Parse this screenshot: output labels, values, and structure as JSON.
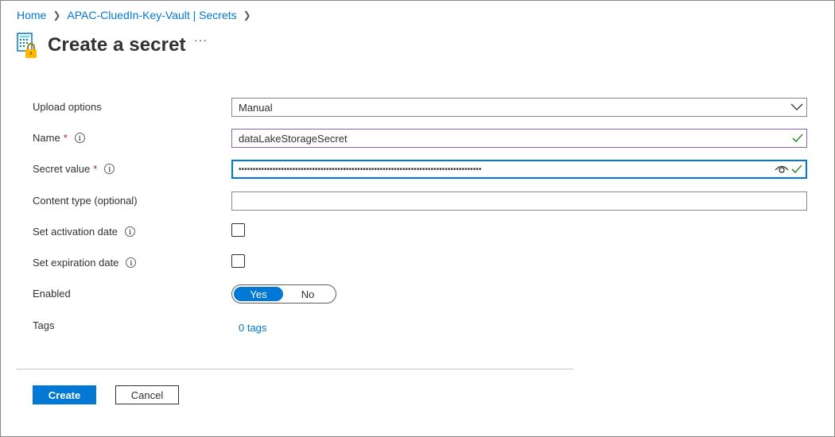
{
  "breadcrumb": {
    "home": "Home",
    "vault": "APAC-CluedIn-Key-Vault | Secrets"
  },
  "header": {
    "title": "Create a secret",
    "more": "···"
  },
  "form": {
    "upload_options": {
      "label": "Upload options",
      "value": "Manual"
    },
    "name": {
      "label": "Name",
      "required": "*",
      "value": "dataLakeStorageSecret"
    },
    "secret_value": {
      "label": "Secret value",
      "required": "*",
      "value": "••••••••••••••••••••••••••••••••••••••••••••••••••••••••••••••••••••••••••••••••••••••"
    },
    "content_type": {
      "label": "Content type (optional)",
      "value": ""
    },
    "activation_date": {
      "label": "Set activation date"
    },
    "expiration_date": {
      "label": "Set expiration date"
    },
    "enabled": {
      "label": "Enabled",
      "yes": "Yes",
      "no": "No",
      "selected": "Yes"
    },
    "tags": {
      "label": "Tags",
      "link": "0 tags"
    }
  },
  "footer": {
    "create": "Create",
    "cancel": "Cancel"
  },
  "colors": {
    "accent": "#0078d4",
    "valid": "#107c10",
    "required": "#a4262c"
  }
}
